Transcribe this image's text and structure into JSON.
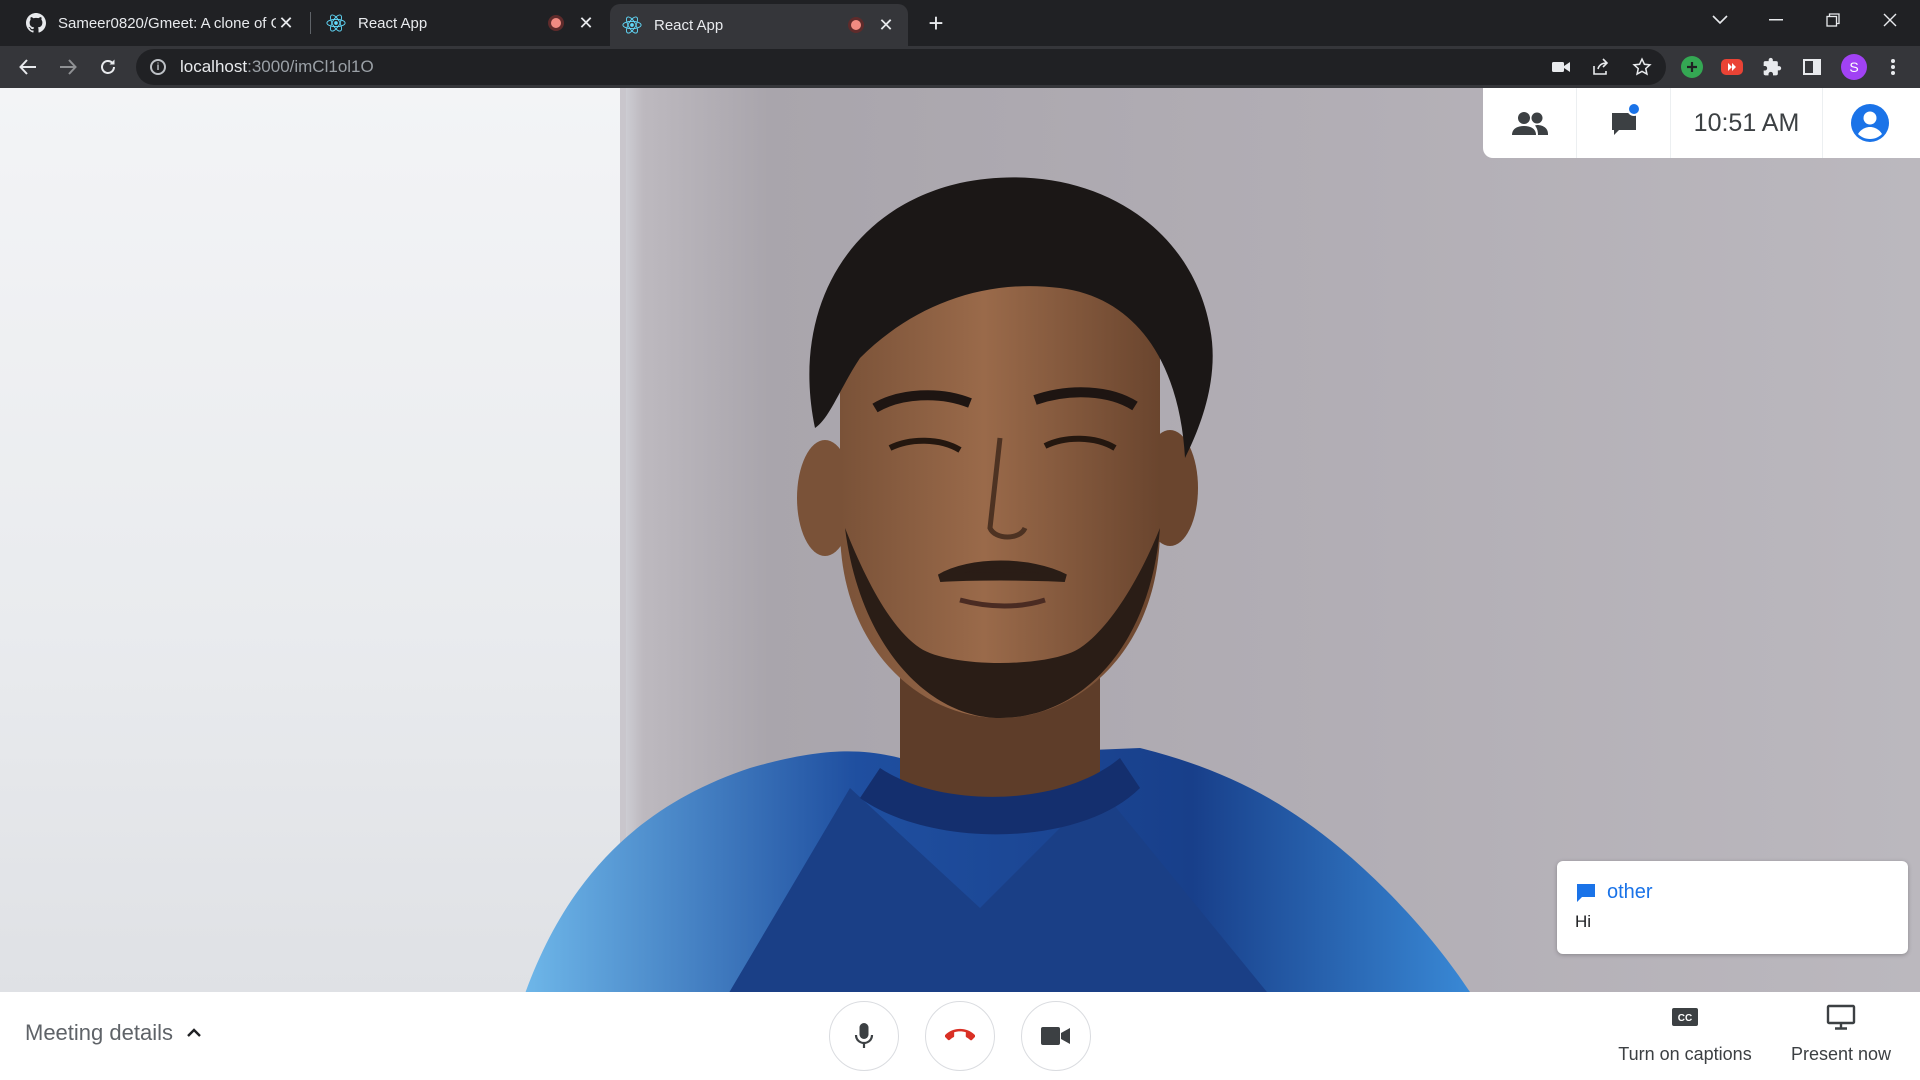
{
  "browser": {
    "tabs": [
      {
        "title": "Sameer0820/Gmeet: A clone of G",
        "favicon": "github-icon"
      },
      {
        "title": "React App",
        "favicon": "react-icon",
        "recording": true
      },
      {
        "title": "React App",
        "favicon": "react-icon",
        "recording": true,
        "active": true
      }
    ],
    "new_tab_label": "+",
    "url_host": "localhost",
    "url_path": ":3000/imCl1ol1O",
    "profile_initial": "S"
  },
  "meeting": {
    "time": "10:51 AM",
    "details_label": "Meeting details",
    "captions_label": "Turn on captions",
    "present_label": "Present now",
    "captions_icon_text": "CC"
  },
  "notification": {
    "sender": "other",
    "message": "Hi"
  },
  "colors": {
    "accent": "#1a73e8",
    "hangup": "#d93025",
    "chrome_dark": "#202124",
    "chrome_toolbar": "#35363a"
  }
}
